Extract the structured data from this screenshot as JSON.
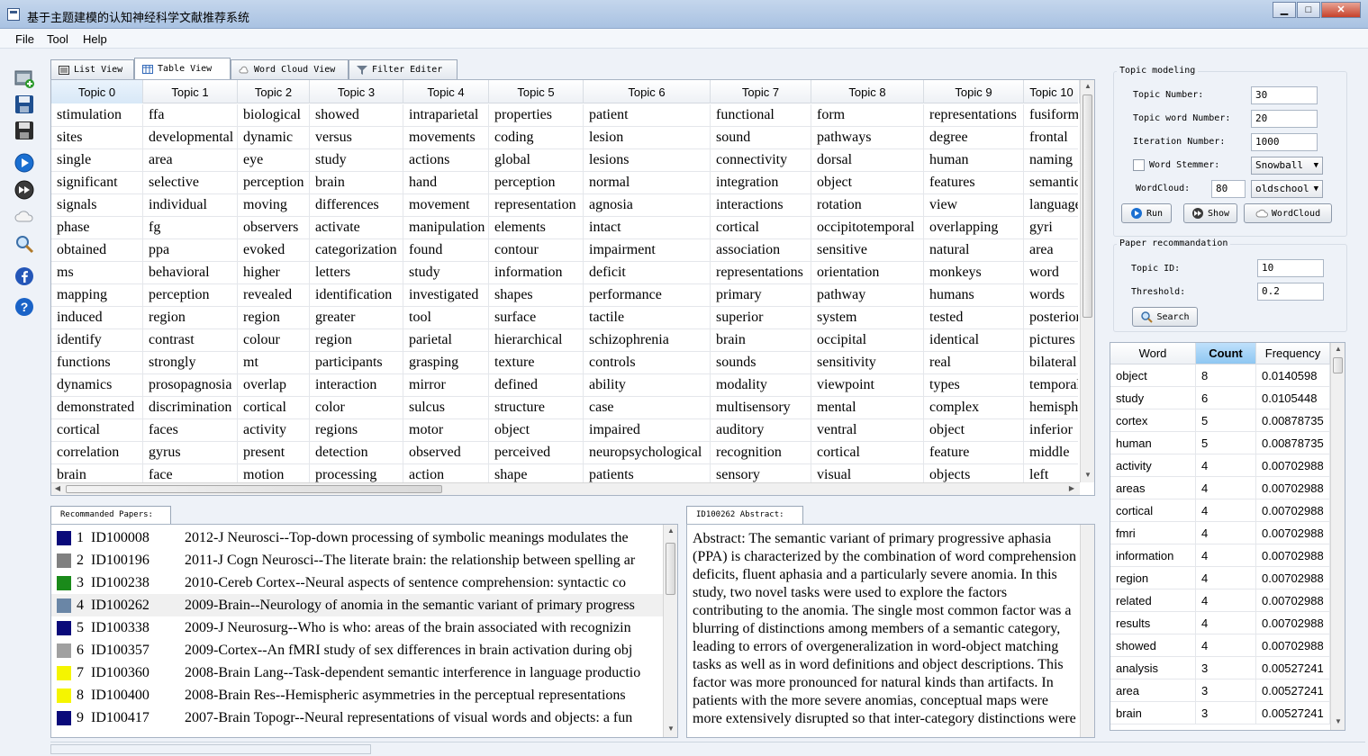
{
  "window": {
    "title": "基于主题建模的认知神经科学文献推荐系统",
    "controls": [
      "▁",
      "□",
      "✕"
    ]
  },
  "menu": [
    "File",
    "Tool",
    "Help"
  ],
  "toolbar": [
    "add-image-icon",
    "save-icon",
    "save-as-icon",
    "play-icon",
    "fast-forward-icon",
    "cloud-icon",
    "search-icon",
    "facebook-icon",
    "help-icon"
  ],
  "tabs": [
    {
      "label": "List View"
    },
    {
      "label": "Table View"
    },
    {
      "label": "Word Cloud View"
    },
    {
      "label": "Filter Editer"
    }
  ],
  "topics": {
    "headers": [
      "Topic 0",
      "Topic 1",
      "Topic 2",
      "Topic 3",
      "Topic 4",
      "Topic 5",
      "Topic 6",
      "Topic 7",
      "Topic 8",
      "Topic 9",
      "Topic 10"
    ],
    "rows": [
      [
        "stimulation",
        "ffa",
        "biological",
        "showed",
        "intraparietal",
        "properties",
        "patient",
        "functional",
        "form",
        "representations",
        "fusiform"
      ],
      [
        "sites",
        "developmental",
        "dynamic",
        "versus",
        "movements",
        "coding",
        "lesion",
        "sound",
        "pathways",
        "degree",
        "frontal"
      ],
      [
        "single",
        "area",
        "eye",
        "study",
        "actions",
        "global",
        "lesions",
        "connectivity",
        "dorsal",
        "human",
        "naming"
      ],
      [
        "significant",
        "selective",
        "perception",
        "brain",
        "hand",
        "perception",
        "normal",
        "integration",
        "object",
        "features",
        "semantic"
      ],
      [
        "signals",
        "individual",
        "moving",
        "differences",
        "movement",
        "representation",
        "agnosia",
        "interactions",
        "rotation",
        "view",
        "language"
      ],
      [
        "phase",
        "fg",
        "observers",
        "activate",
        "manipulation",
        "elements",
        "intact",
        "cortical",
        "occipitotemporal",
        "overlapping",
        "gyri"
      ],
      [
        "obtained",
        "ppa",
        "evoked",
        "categorization",
        "found",
        "contour",
        "impairment",
        "association",
        "sensitive",
        "natural",
        "area"
      ],
      [
        "ms",
        "behavioral",
        "higher",
        "letters",
        "study",
        "information",
        "deficit",
        "representations",
        "orientation",
        "monkeys",
        "word"
      ],
      [
        "mapping",
        "perception",
        "revealed",
        "identification",
        "investigated",
        "shapes",
        "performance",
        "primary",
        "pathway",
        "humans",
        "words"
      ],
      [
        "induced",
        "region",
        "region",
        "greater",
        "tool",
        "surface",
        "tactile",
        "superior",
        "system",
        "tested",
        "posterior"
      ],
      [
        "identify",
        "contrast",
        "colour",
        "region",
        "parietal",
        "hierarchical",
        "schizophrenia",
        "brain",
        "occipital",
        "identical",
        "pictures"
      ],
      [
        "functions",
        "strongly",
        "mt",
        "participants",
        "grasping",
        "texture",
        "controls",
        "sounds",
        "sensitivity",
        "real",
        "bilateral"
      ],
      [
        "dynamics",
        "prosopagnosia",
        "overlap",
        "interaction",
        "mirror",
        "defined",
        "ability",
        "modality",
        "viewpoint",
        "types",
        "temporal"
      ],
      [
        "demonstrated",
        "discrimination",
        "cortical",
        "color",
        "sulcus",
        "structure",
        "case",
        "multisensory",
        "mental",
        "complex",
        "hemisphere"
      ],
      [
        "cortical",
        "faces",
        "activity",
        "regions",
        "motor",
        "object",
        "impaired",
        "auditory",
        "ventral",
        "object",
        "inferior"
      ],
      [
        "correlation",
        "gyrus",
        "present",
        "detection",
        "observed",
        "perceived",
        "neuropsychological",
        "recognition",
        "cortical",
        "feature",
        "middle"
      ],
      [
        "brain",
        "face",
        "motion",
        "processing",
        "action",
        "shape",
        "patients",
        "sensory",
        "visual",
        "objects",
        "left"
      ]
    ]
  },
  "papers": {
    "tab": "Recommanded Papers:",
    "items": [
      {
        "num": "1",
        "id": "ID100008",
        "title": "2012-J Neurosci--Top-down processing of symbolic meanings modulates the",
        "color": "#0a0a7a"
      },
      {
        "num": "2",
        "id": "ID100196",
        "title": "2011-J Cogn Neurosci--The literate brain: the relationship between spelling ar",
        "color": "#808080"
      },
      {
        "num": "3",
        "id": "ID100238",
        "title": "2010-Cereb Cortex--Neural aspects of sentence comprehension: syntactic co",
        "color": "#1a8a1a"
      },
      {
        "num": "4",
        "id": "ID100262",
        "title": "2009-Brain--Neurology of anomia in the semantic variant of primary progress",
        "color": "#6a86a6"
      },
      {
        "num": "5",
        "id": "ID100338",
        "title": "2009-J Neurosurg--Who is who: areas of the brain associated with recognizin",
        "color": "#0a0a7a"
      },
      {
        "num": "6",
        "id": "ID100357",
        "title": "2009-Cortex--An fMRI study of sex differences in brain activation during obj",
        "color": "#a0a0a0"
      },
      {
        "num": "7",
        "id": "ID100360",
        "title": "2008-Brain Lang--Task-dependent semantic interference in language productio",
        "color": "#f5f500"
      },
      {
        "num": "8",
        "id": "ID100400",
        "title": "2008-Brain Res--Hemispheric asymmetries in the perceptual representations",
        "color": "#f5f500"
      },
      {
        "num": "9",
        "id": "ID100417",
        "title": "2007-Brain Topogr--Neural representations of visual words and objects: a fun",
        "color": "#0a0a7a"
      }
    ],
    "selected_index": 3
  },
  "abstract": {
    "tab": "ID100262 Abstract:",
    "text": "Abstract:    The semantic variant of primary progressive aphasia (PPA) is characterized by the combination of word comprehension deficits, fluent aphasia and a particularly severe anomia. In this study, two novel tasks were used to explore the factors contributing to the anomia. The single most common factor was a blurring of distinctions among members of a semantic category, leading to errors of overgeneralization in word-object matching tasks as well as in word definitions and object descriptions. This factor was more pronounced for natural kinds than artifacts. In patients with the more severe anomias, conceptual maps were more extensively disrupted so that inter-category distinctions were"
  },
  "topic_modeling": {
    "title": "Topic modeling",
    "topic_number_label": "Topic Number:",
    "topic_number": "30",
    "topic_word_number_label": "Topic word Number:",
    "topic_word_number": "20",
    "iteration_number_label": "Iteration Number:",
    "iteration_number": "1000",
    "stemmer_label": "Word Stemmer:",
    "stemmer_checked": false,
    "stemmer_value": "Snowball",
    "wordcloud_label": "WordCloud:",
    "wordcloud_number": "80",
    "wordcloud_style": "oldschool",
    "run_label": "Run",
    "show_label": "Show",
    "wordcloud_button_label": "WordCloud"
  },
  "recommendation": {
    "title": "Paper recommandation",
    "topic_id_label": "Topic ID:",
    "topic_id": "10",
    "threshold_label": "Threshold:",
    "threshold": "0.2",
    "search_label": "Search"
  },
  "word_freq": {
    "headers": [
      "Word",
      "Count",
      "Frequency"
    ],
    "sorted_column": "Count",
    "rows": [
      [
        "object",
        "8",
        "0.0140598"
      ],
      [
        "study",
        "6",
        "0.0105448"
      ],
      [
        "cortex",
        "5",
        "0.00878735"
      ],
      [
        "human",
        "5",
        "0.00878735"
      ],
      [
        "activity",
        "4",
        "0.00702988"
      ],
      [
        "areas",
        "4",
        "0.00702988"
      ],
      [
        "cortical",
        "4",
        "0.00702988"
      ],
      [
        "fmri",
        "4",
        "0.00702988"
      ],
      [
        "information",
        "4",
        "0.00702988"
      ],
      [
        "region",
        "4",
        "0.00702988"
      ],
      [
        "related",
        "4",
        "0.00702988"
      ],
      [
        "results",
        "4",
        "0.00702988"
      ],
      [
        "showed",
        "4",
        "0.00702988"
      ],
      [
        "analysis",
        "3",
        "0.00527241"
      ],
      [
        "area",
        "3",
        "0.00527241"
      ],
      [
        "brain",
        "3",
        "0.00527241"
      ]
    ]
  }
}
